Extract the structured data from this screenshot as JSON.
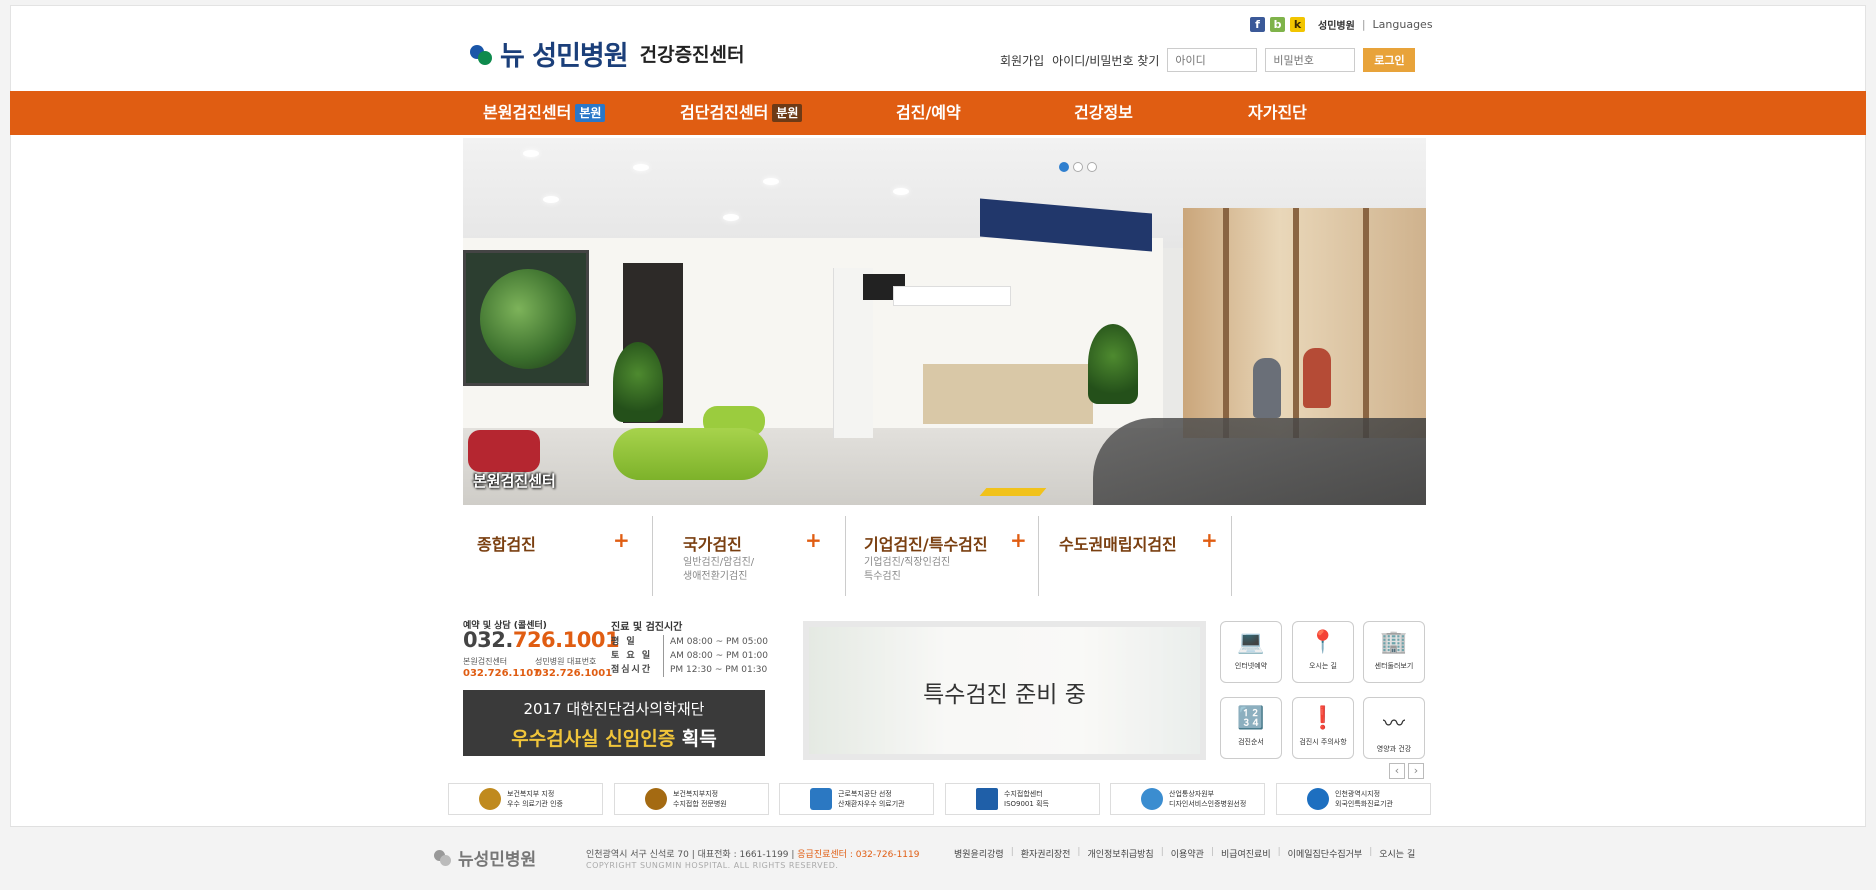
{
  "brand": {
    "name": "뉴 성민병원",
    "sub": "건강증진센터"
  },
  "util": {
    "hospital_link": "성민병원",
    "languages": "Languages",
    "join": "회원가입",
    "find_id": "아이디/비밀번호 찾기",
    "id_placeholder": "아이디",
    "pw_placeholder": "비밀번호",
    "login": "로그인"
  },
  "nav": [
    {
      "label": "본원검진센터",
      "tag": "본원"
    },
    {
      "label": "검단검진센터",
      "tag": "분원"
    },
    {
      "label": "검진/예약"
    },
    {
      "label": "건강정보"
    },
    {
      "label": "자가진단"
    }
  ],
  "hero": {
    "caption": "본원검진센터",
    "slides": 3,
    "active_slide": 1
  },
  "quick": [
    {
      "title": "종합검진",
      "plus": "+",
      "lines": []
    },
    {
      "title": "국가검진",
      "plus": "+",
      "lines": [
        "일반검진/암검진/",
        "생애전환기검진"
      ]
    },
    {
      "title": "기업검진/특수검진",
      "plus": "+",
      "lines": [
        "기업검진/직장인검진",
        "특수검진"
      ]
    },
    {
      "title": "수도권매립지검진",
      "plus": "+",
      "lines": []
    }
  ],
  "contact": {
    "label": "예약 및 상담 (콜센터)",
    "phone_pre": "032.",
    "phone_main": "726.1001",
    "sub1_label": "본원검진센터",
    "sub1": "032.726.1107",
    "sub2_label": "성민병원 대표번호",
    "sub2": "032.726.1001",
    "hours_title": "진료 및 검진시간",
    "hours": [
      {
        "day": "평 일",
        "time": "AM 08:00 ~ PM 05:00"
      },
      {
        "day": "토 요 일",
        "time": "AM 08:00 ~ PM 01:00"
      },
      {
        "day": "점심시간",
        "time": "PM 12:30 ~ PM 01:30"
      }
    ]
  },
  "award": {
    "line1": "2017 대한진단검사의학재단",
    "line2a": "우수검사실 신임인증",
    "line2b": " 획득"
  },
  "promo": {
    "text": "특수검진 준비 중"
  },
  "icon_buttons": [
    {
      "label": "인터넷예약",
      "icon": "laptop-icon",
      "glyph": "💻"
    },
    {
      "label": "오시는 길",
      "icon": "location-pin-icon",
      "glyph": "📍"
    },
    {
      "label": "센터둘러보기",
      "icon": "building-icon",
      "glyph": "🏢"
    },
    {
      "label": "검진순서",
      "icon": "order-number-icon",
      "glyph": "🔢"
    },
    {
      "label": "검진시 주의사항",
      "icon": "caution-icon",
      "glyph": "❗"
    },
    {
      "label": "영양과 건강",
      "icon": "health-wave-icon",
      "glyph": "〰"
    }
  ],
  "certs": [
    {
      "line1": "보건복지부 지정",
      "line2": "우수 의료기관 인증",
      "color": "#c08a1e"
    },
    {
      "line1": "보건복지부지정",
      "line2": "수지접합 전문병원",
      "color": "#a46a12"
    },
    {
      "line1": "근로복지공단 선정",
      "line2": "산재환자우수 의료기관",
      "color": "#2b78c2"
    },
    {
      "line1": "수지접합센터",
      "line2": "ISO9001 획득",
      "color": "#1f5fa8"
    },
    {
      "line1": "산업통상자원부",
      "line2": "디자인서비스인증병원선정",
      "color": "#3b8dd0"
    },
    {
      "line1": "인천광역시지정",
      "line2": "외국인특화진료기관",
      "color": "#1d6fc0"
    }
  ],
  "footer": {
    "logo": "뉴성민병원",
    "address": "인천광역시 서구 신석로 70 | 대표전화 : 1661-1199 | ",
    "emergency": "응급진료센터 : 032-726-1119",
    "copyright": "COPYRIGHT SUNGMIN HOSPITAL. ALL RIGHTS RESERVED.",
    "links": [
      "병원윤리강령",
      "환자권리장전",
      "개인정보취급방침",
      "이용약관",
      "비급여진료비",
      "이메일집단수집거부",
      "오시는 길"
    ]
  },
  "colors": {
    "accent": "#e05d12",
    "brand_blue": "#1b3f7a",
    "login_btn": "#e8a33a"
  }
}
